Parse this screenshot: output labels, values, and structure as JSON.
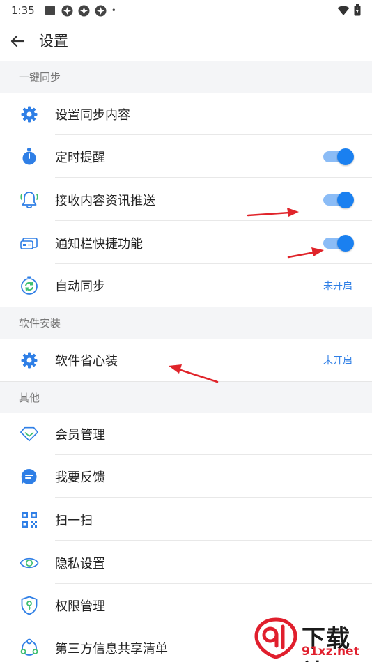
{
  "status_bar": {
    "time": "1:35",
    "dot": "•"
  },
  "app_bar": {
    "title": "设置"
  },
  "sections": [
    {
      "header": "一键同步"
    },
    {
      "header": "软件安装"
    },
    {
      "header": "其他"
    }
  ],
  "sync": {
    "sync_content": "设置同步内容",
    "reminder": "定时提醒",
    "push": "接收内容资讯推送",
    "shortcut": "通知栏快捷功能",
    "auto_sync": "自动同步",
    "auto_sync_value": "未开启",
    "toggles": {
      "reminder": true,
      "push": true,
      "shortcut": true
    }
  },
  "install": {
    "easy_install": "软件省心装",
    "easy_install_value": "未开启"
  },
  "other": {
    "membership": "会员管理",
    "feedback": "我要反馈",
    "scan": "扫一扫",
    "privacy": "隐私设置",
    "permission": "权限管理",
    "third_party": "第三方信息共享清单"
  },
  "watermark": {
    "brand": "下载站",
    "url": "91xz.net"
  },
  "colors": {
    "accent": "#1a80f0",
    "value_text": "#2f7fe6",
    "section_bg": "#f4f5f7",
    "annotation": "#e0242a"
  },
  "icons": [
    "gear-icon",
    "stopwatch-icon",
    "bell-icon",
    "notification-card-icon",
    "sync-icon",
    "gear-icon",
    "diamond-icon",
    "chat-bubble-icon",
    "qr-code-icon",
    "eye-icon",
    "shield-key-icon",
    "share-circle-icon"
  ]
}
